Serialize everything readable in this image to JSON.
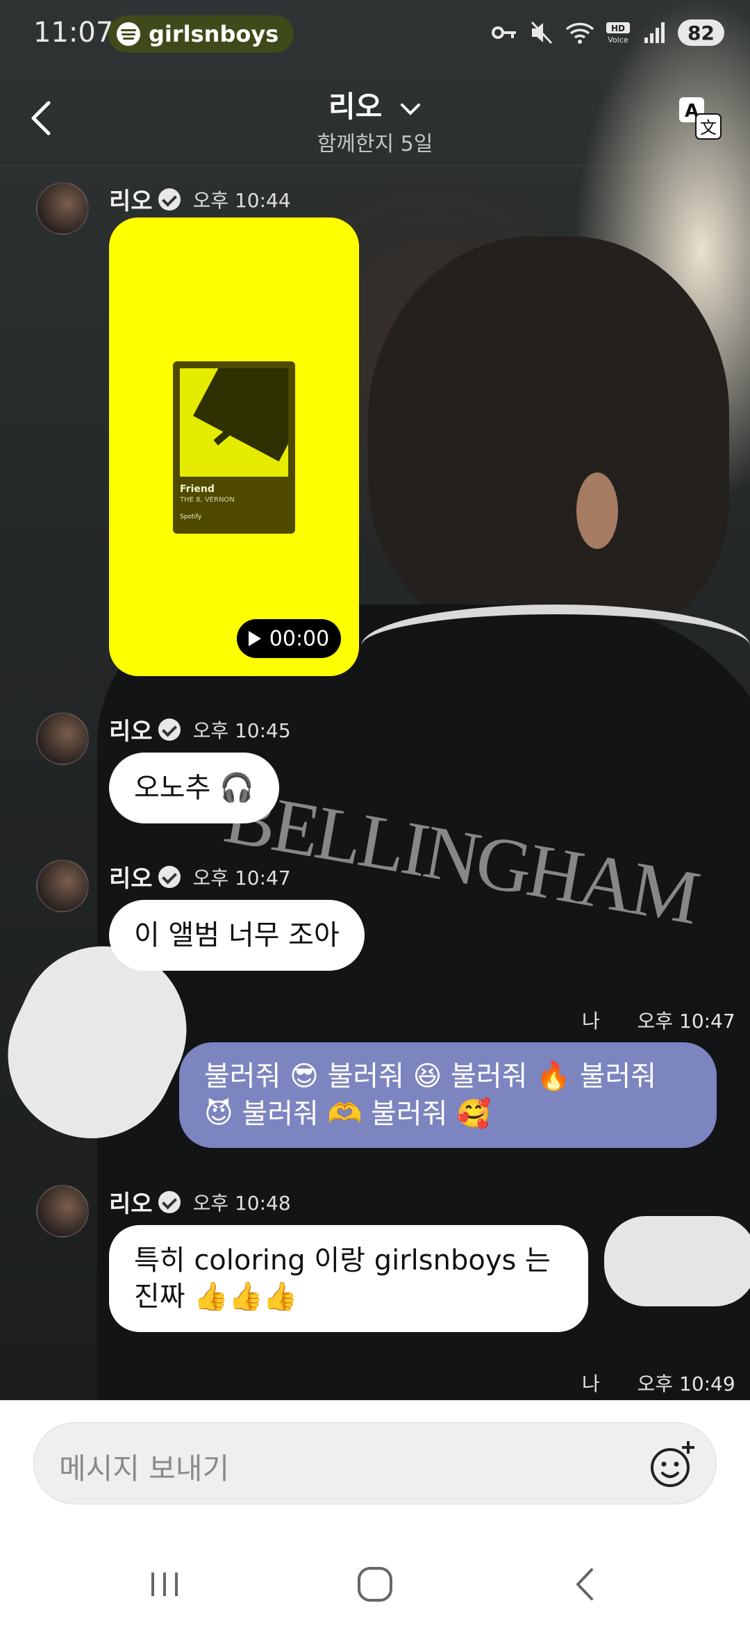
{
  "status_bar": {
    "time": "11:07",
    "now_playing_app": "girlsnboys",
    "battery": "82"
  },
  "header": {
    "title": "리오",
    "subtitle": "함께한지 5일"
  },
  "messages": [
    {
      "sender": "리오",
      "time": "오후 10:44",
      "type": "music_card",
      "song": "Friend",
      "artist": "THE 8, VERNON",
      "brand": "Spotify",
      "duration": "00:00"
    },
    {
      "sender": "리오",
      "time": "오후 10:45",
      "text": "오노추 🎧"
    },
    {
      "sender": "리오",
      "time": "오후 10:47",
      "text": "이 앨범 너무 조아"
    },
    {
      "sender": "나",
      "time": "오후 10:47",
      "text_line1": "불러줘 😎 불러줘 😆 불러줘 🔥 불러줘",
      "text_line2": "😈 불러줘 🫶 불러줘 🥰"
    },
    {
      "sender": "리오",
      "time": "오후 10:48",
      "text_line1": "특히 coloring 이랑 girlsnboys 는",
      "text_line2": "진짜 👍👍👍"
    },
    {
      "sender": "나",
      "time": "오후 10:49"
    }
  ],
  "background": {
    "jersey_text": "BELLINGHAM"
  },
  "composer": {
    "placeholder": "메시지 보내기"
  },
  "colors": {
    "outgoing_bubble": "#7c85bf",
    "music_card": "#ffff00"
  }
}
